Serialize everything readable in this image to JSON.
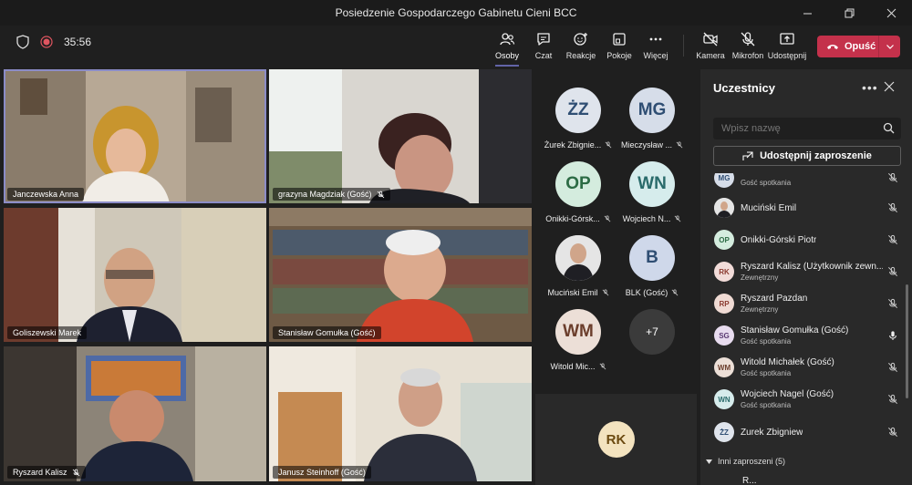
{
  "window": {
    "title": "Posiedzenie Gospodarczego Gabinetu Cieni BCC"
  },
  "toolbar": {
    "timer": "35:56",
    "buttons": [
      {
        "label": "Osoby",
        "icon": "people-icon"
      },
      {
        "label": "Czat",
        "icon": "chat-icon"
      },
      {
        "label": "Reakcje",
        "icon": "reactions-icon"
      },
      {
        "label": "Pokoje",
        "icon": "rooms-icon"
      },
      {
        "label": "Więcej",
        "icon": "more-icon"
      },
      {
        "label": "Kamera",
        "icon": "camera-off-icon"
      },
      {
        "label": "Mikrofon",
        "icon": "mic-off-icon"
      },
      {
        "label": "Udostępnij",
        "icon": "share-icon"
      }
    ],
    "leave_label": "Opuść"
  },
  "videos": [
    {
      "name": "Janczewska Anna"
    },
    {
      "name": "grazyna Magdziak (Gość)"
    },
    {
      "name": "Goliszewski Marek"
    },
    {
      "name": "Stanisław Gomułka (Gość)"
    },
    {
      "name": "Ryszard Kalisz"
    },
    {
      "name": "Janusz Steinhoff (Gość)"
    }
  ],
  "roster": [
    {
      "initials": "ŻZ",
      "name": "Żurek Zbignie...",
      "color": "#dfe4ec"
    },
    {
      "initials": "MG",
      "name": "Mieczysław ...",
      "color": "#d6dde9"
    },
    {
      "initials": "OP",
      "name": "Onikki-Górsk...",
      "color": "#d4ecde"
    },
    {
      "initials": "WN",
      "name": "Wojciech N...",
      "color": "#d6ecec"
    },
    {
      "initials": "",
      "name": "Muciński Emil",
      "color": "#c9c9c9"
    },
    {
      "initials": "B",
      "name": "BLK (Gość)",
      "color": "#cfd8ea"
    },
    {
      "initials": "WM",
      "name": "Witold Mic...",
      "color": "#ecdfd7"
    },
    {
      "initials": "+7",
      "name": "",
      "color": "#3b3b3b"
    }
  ],
  "bottom_tile": {
    "initials": "RK",
    "color": "#f3e3bf"
  },
  "panel": {
    "title": "Uczestnicy",
    "search_placeholder": "Wpisz nazwę",
    "share_invite": "Udostępnij zaproszenie",
    "participants": [
      {
        "initials": "MG",
        "name": "",
        "sub": "Gość spotkania",
        "color": "#d6dde9",
        "mic": "off"
      },
      {
        "initials": "",
        "name": "Muciński Emil",
        "sub": "",
        "color": "#c9c9c9",
        "mic": "off"
      },
      {
        "initials": "OP",
        "name": "Onikki-Górski Piotr",
        "sub": "",
        "color": "#d4ecde",
        "mic": "off"
      },
      {
        "initials": "RK",
        "name": "Ryszard Kalisz (Użytkownik zewn...",
        "sub": "Zewnętrzny",
        "color": "#f2dcd9",
        "mic": "off"
      },
      {
        "initials": "RP",
        "name": "Ryszard Pazdan",
        "sub": "Zewnętrzny",
        "color": "#f0dbd4",
        "mic": "off"
      },
      {
        "initials": "SG",
        "name": "Stanisław Gomułka (Gość)",
        "sub": "Gość spotkania",
        "color": "#e8dcef",
        "mic": "on"
      },
      {
        "initials": "WM",
        "name": "Witold Michałek (Gość)",
        "sub": "Gość spotkania",
        "color": "#ecdfd7",
        "mic": "off"
      },
      {
        "initials": "WN",
        "name": "Wojciech Nagel (Gość)",
        "sub": "Gość spotkania",
        "color": "#d6ecec",
        "mic": "off"
      },
      {
        "initials": "ŻZ",
        "name": "Żurek Zbigniew",
        "sub": "",
        "color": "#dfe4ec",
        "mic": "off"
      }
    ],
    "section_others": "Inni zaproszeni (5)",
    "partial_last": "R..."
  }
}
